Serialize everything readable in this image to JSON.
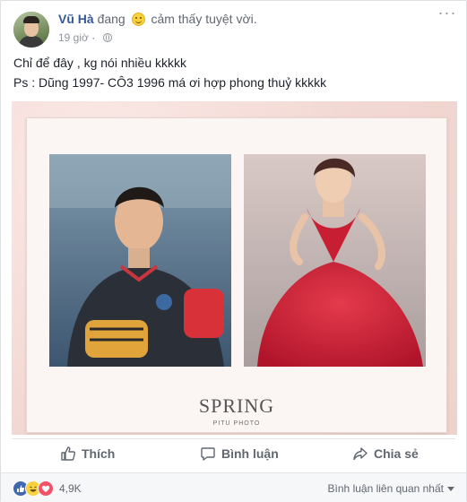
{
  "post": {
    "author": "Vũ Hà",
    "status_prefix": "đang",
    "status_feeling": "cảm thấy tuyệt vời.",
    "time": "19 giờ",
    "privacy_icon": "globe-icon",
    "lines": [
      "Chỉ để đây , kg nói nhiều kkkkk",
      "Ps : Dũng 1997- CÔ3 1996 má ơi hợp phong thuỷ kkkkk"
    ],
    "photo": {
      "caption": "SPRING",
      "watermark": "PITU PHOTO"
    }
  },
  "actions": {
    "like": "Thích",
    "comment": "Bình luận",
    "share": "Chia sẻ"
  },
  "footer": {
    "reaction_icons": [
      "like-icon",
      "haha-icon",
      "love-icon"
    ],
    "reaction_count": "4,9K",
    "sort_label": "Bình luận liên quan nhất"
  },
  "colors": {
    "link": "#365899",
    "like": "#4267b2",
    "love": "#f25268",
    "haha": "#f7d23c"
  }
}
